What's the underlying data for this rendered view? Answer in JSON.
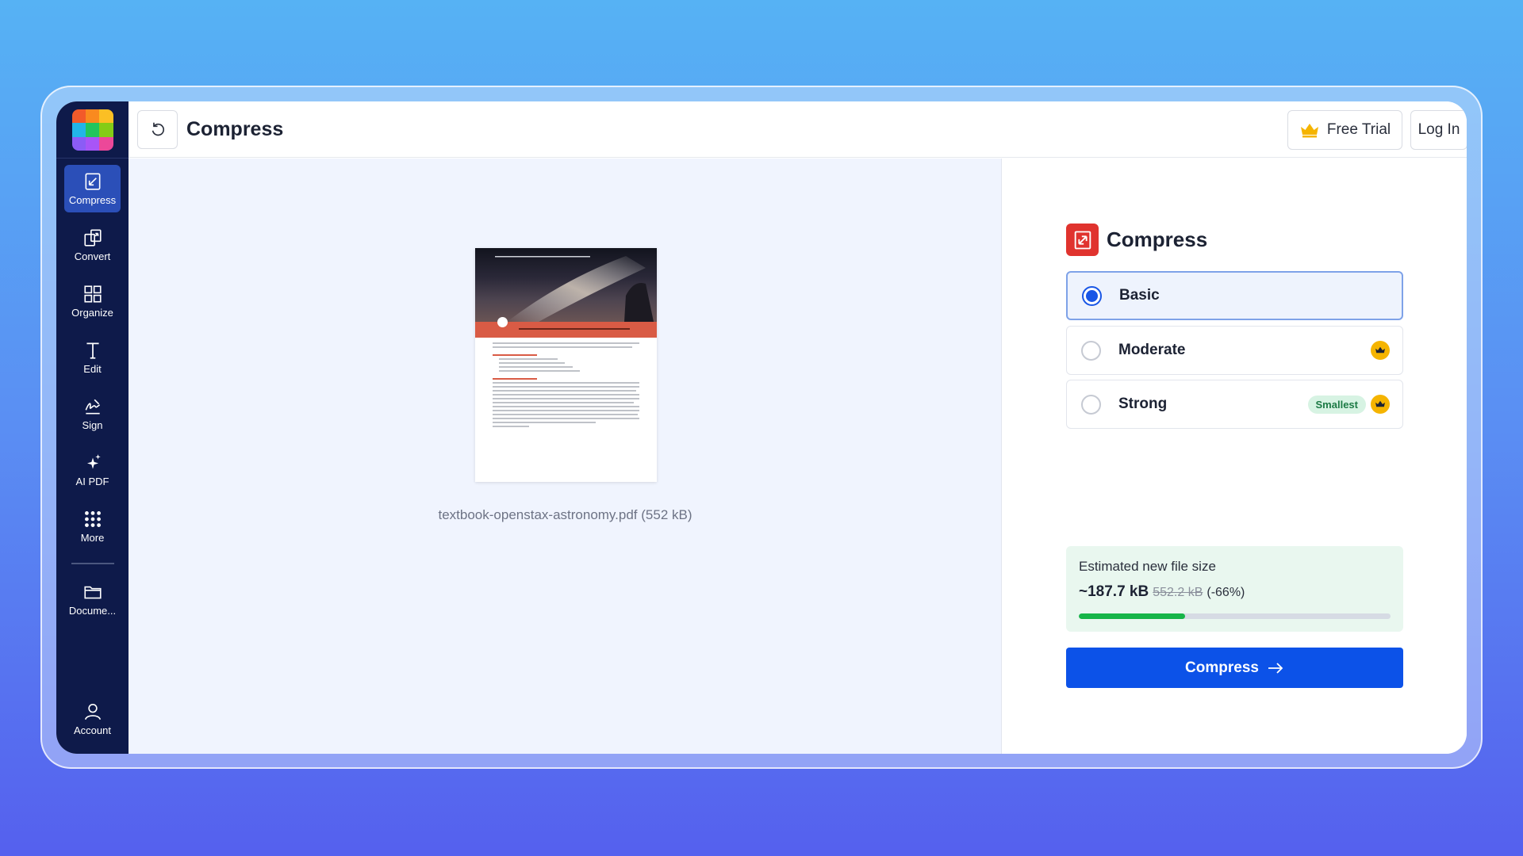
{
  "sidebar": {
    "logo_colors": [
      "#f25a2a",
      "#f98a1f",
      "#fbbf24",
      "#22b5e8",
      "#22c55e",
      "#84cc16",
      "#8b5cf6",
      "#a855f7",
      "#ec4899"
    ],
    "items": [
      {
        "label": "Compress",
        "icon": "compress-icon",
        "active": true
      },
      {
        "label": "Convert",
        "icon": "convert-icon"
      },
      {
        "label": "Organize",
        "icon": "organize-icon"
      },
      {
        "label": "Edit",
        "icon": "edit-icon"
      },
      {
        "label": "Sign",
        "icon": "sign-icon"
      },
      {
        "label": "AI PDF",
        "icon": "sparkle-icon"
      },
      {
        "label": "More",
        "icon": "more-grid-icon"
      }
    ],
    "documents_label": "Docume...",
    "account_label": "Account"
  },
  "header": {
    "title": "Compress",
    "free_trial": "Free Trial",
    "login": "Log In"
  },
  "preview": {
    "file_caption": "textbook-openstax-astronomy.pdf (552 kB)"
  },
  "panel": {
    "title": "Compress",
    "options": [
      {
        "label": "Basic",
        "selected": true
      },
      {
        "label": "Moderate",
        "premium": true
      },
      {
        "label": "Strong",
        "badge": "Smallest",
        "premium": true
      }
    ],
    "estimate": {
      "label": "Estimated new file size",
      "new_size": "~187.7 kB",
      "old_size": "552.2 kB",
      "change": "(-66%)",
      "progress": 0.34
    },
    "button": "Compress",
    "colors": {
      "accent": "#0c52e8",
      "danger": "#e0332e",
      "premium": "#f5b400",
      "success": "#16b548"
    }
  }
}
